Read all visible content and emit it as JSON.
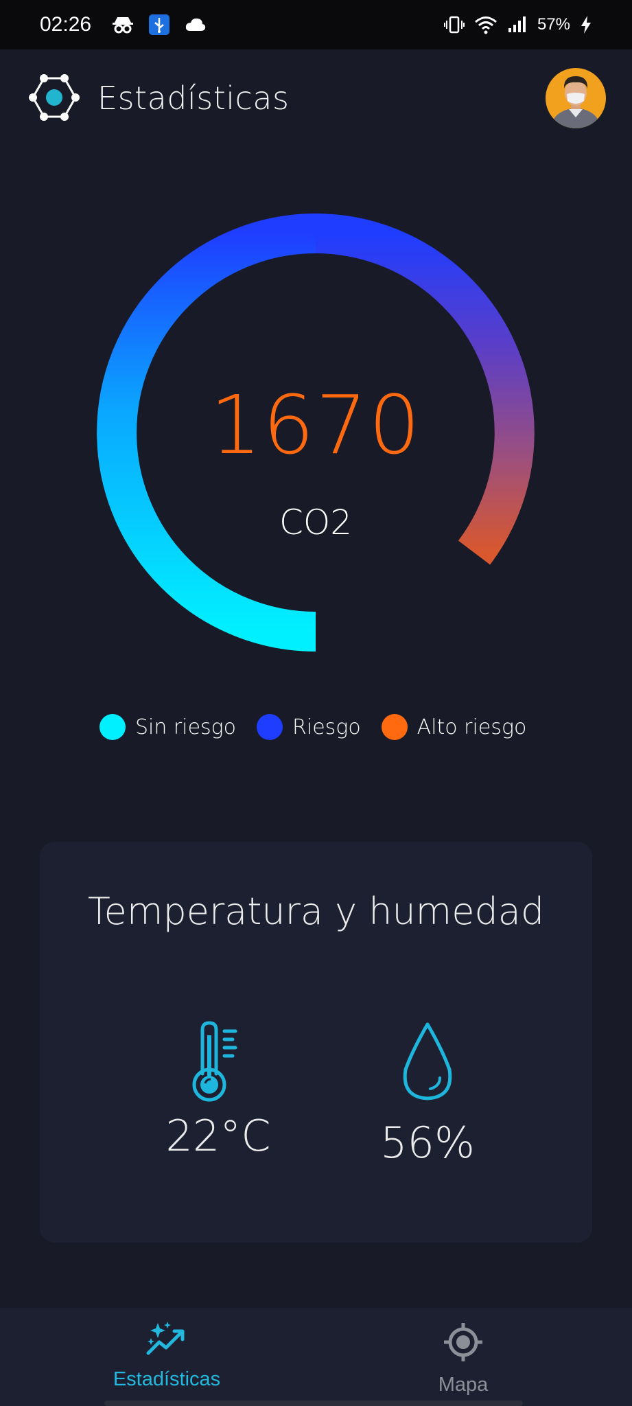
{
  "status_bar": {
    "time": "02:26",
    "battery": "57%",
    "icons": [
      "incognito-icon",
      "usb-icon",
      "cloud-icon",
      "vibrate-icon",
      "wifi-icon",
      "signal-icon",
      "charging-icon"
    ]
  },
  "header": {
    "title": "Estadísticas",
    "logo_icon": "molecule-icon",
    "avatar_icon": "user-avatar"
  },
  "gauge": {
    "value": "1670",
    "label": "CO2",
    "gradient_colors": [
      "#00f0ff",
      "#1f3dff",
      "#ff6a10"
    ]
  },
  "legend": [
    {
      "label": "Sin riesgo",
      "color": "#00f0ff"
    },
    {
      "label": "Riesgo",
      "color": "#1f3dff"
    },
    {
      "label": "Alto riesgo",
      "color": "#ff6a10"
    }
  ],
  "card": {
    "title": "Temperatura y humedad",
    "temperature": {
      "value": "22°C",
      "icon": "thermometer-icon"
    },
    "humidity": {
      "value": "56%",
      "icon": "water-drop-icon"
    }
  },
  "bottom_nav": {
    "items": [
      {
        "label": "Estadísticas",
        "icon": "sparkle-chart-icon",
        "active": true
      },
      {
        "label": "Mapa",
        "icon": "location-target-icon",
        "active": false
      }
    ]
  },
  "colors": {
    "background": "#181b27",
    "card": "#1d2030",
    "accent": "#23b8de",
    "value_orange": "#ff6a10"
  }
}
